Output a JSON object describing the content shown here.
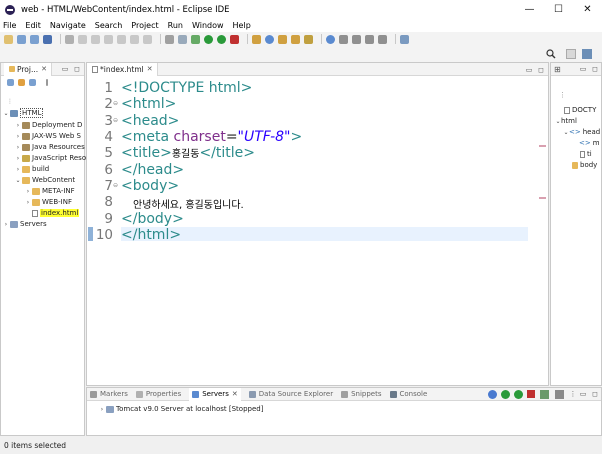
{
  "window": {
    "title": "web - HTML/WebContent/index.html - Eclipse IDE"
  },
  "menu": [
    "File",
    "Edit",
    "Navigate",
    "Search",
    "Project",
    "Run",
    "Window",
    "Help"
  ],
  "explorer": {
    "tab_label": "Proj...",
    "tree": [
      {
        "label": "HTML",
        "depth": 0,
        "icon": "project-icon"
      },
      {
        "label": "Deployment D",
        "depth": 1,
        "icon": "lib-icon"
      },
      {
        "label": "JAX-WS Web S",
        "depth": 1,
        "icon": "lib-icon"
      },
      {
        "label": "Java Resources",
        "depth": 1,
        "icon": "lib-icon"
      },
      {
        "label": "JavaScript Reso",
        "depth": 1,
        "icon": "js-icon"
      },
      {
        "label": "build",
        "depth": 1,
        "icon": "folder-icon"
      },
      {
        "label": "WebContent",
        "depth": 1,
        "icon": "folder-icon"
      },
      {
        "label": "META-INF",
        "depth": 2,
        "icon": "folder-icon"
      },
      {
        "label": "WEB-INF",
        "depth": 2,
        "icon": "folder-icon"
      },
      {
        "label": "index.html",
        "depth": 2,
        "icon": "file-icon"
      },
      {
        "label": "Servers",
        "depth": 0,
        "icon": "folder-icon"
      }
    ]
  },
  "editor": {
    "tab_label": "*index.html",
    "active_line": 10,
    "line_numbers": [
      "1",
      "2",
      "3",
      "4",
      "5",
      "6",
      "7",
      "8",
      "9",
      "10"
    ],
    "code": {
      "l1": "<!DOCTYPE html>",
      "l2": "<html>",
      "l3": "<head>",
      "l4_tag_open": "<meta ",
      "l4_attr": "charset",
      "l4_eq": "=",
      "l4_val": "\"UTF-8\"",
      "l4_tag_close": ">",
      "l5_open": "<title>",
      "l5_text": "홍길동",
      "l5_close": "</title>",
      "l6": "</head>",
      "l7": "<body>",
      "l8_text": "안녕하세요, 홍길동입니다.",
      "l9": "</body>",
      "l10": "</html>"
    }
  },
  "outline": {
    "items": [
      "DOCTY",
      "html",
      "head",
      "m",
      "ti",
      "body"
    ]
  },
  "bottom_panel": {
    "tabs": [
      "Markers",
      "Properties",
      "Servers",
      "Data Source Explorer",
      "Snippets",
      "Console"
    ],
    "active_tab": "Servers",
    "server_entry": "Tomcat v9.0 Server at localhost  [Stopped]"
  },
  "status": {
    "text": "0 items selected"
  },
  "colors": {
    "tag": "#2c8b8b",
    "attr": "#7f2f8b",
    "value": "#2a00ff",
    "current_line": "#e8f2fe",
    "highlight": "#ffff33"
  }
}
